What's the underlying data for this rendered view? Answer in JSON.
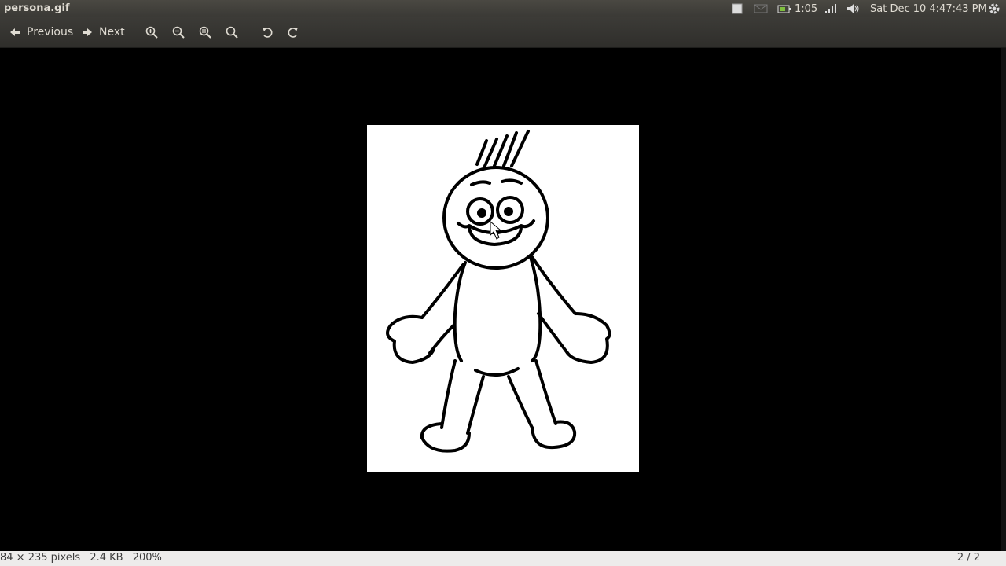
{
  "window": {
    "title": "persona.gif"
  },
  "panel": {
    "battery_time": "1:05",
    "clock": "Sat Dec 10  4:47:43 PM",
    "icons": [
      "app-indicator-icon",
      "mail-icon",
      "battery-icon",
      "network-signal-icon",
      "volume-icon",
      "system-gear-icon"
    ]
  },
  "toolbar": {
    "previous_label": "Previous",
    "next_label": "Next",
    "icons": [
      "zoom-in-icon",
      "zoom-out-icon",
      "zoom-normal-icon",
      "zoom-fit-icon",
      "rotate-left-icon",
      "rotate-right-icon"
    ]
  },
  "status": {
    "dimensions": "84 × 235 pixels",
    "size": "2.4 KB",
    "zoom": "200%",
    "position": "2 / 2"
  },
  "colors": {
    "panel": "#3c3b37",
    "canvas": "#000000",
    "statusbar": "#edeceb"
  }
}
